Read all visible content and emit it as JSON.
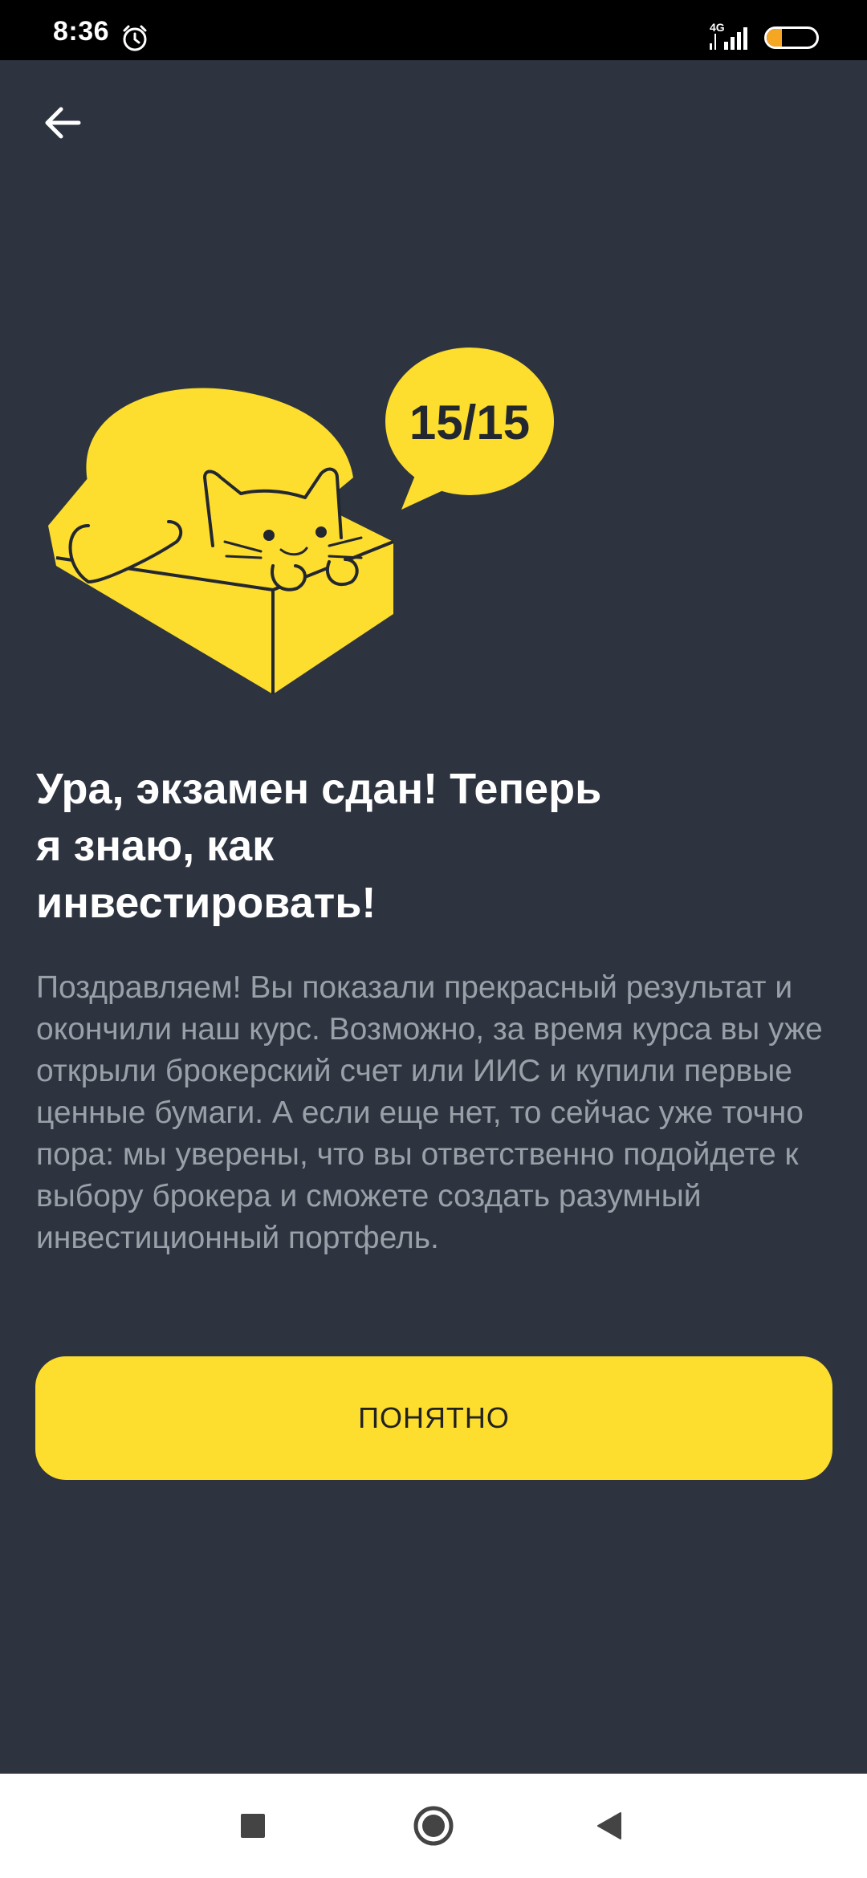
{
  "status_bar": {
    "time": "8:36",
    "network": "4G",
    "battery_level": "31",
    "battery_fraction": 0.31,
    "icons": [
      "alarm-icon",
      "signal-icon",
      "battery-icon"
    ]
  },
  "toolbar": {
    "back_icon": "arrow-left-icon"
  },
  "illustration": {
    "bubble_text": "15/15",
    "icon": "cat-in-box-illustration"
  },
  "content": {
    "title": "Ура, экзамен сдан! Теперь\nя знаю, как\nинвестировать!",
    "body": "Поздравляем! Вы показали прекрасный результат и окончили наш курс. Возможно, за время курса вы уже открыли брокерский счет или ИИС и купили первые ценные бумаги. А если еще нет, то сейчас уже точно пора: мы уверены, что вы ответственно подойдете к выбору брокера и сможете создать разумный инвестиционный портфель."
  },
  "button": {
    "label": "ПОНЯТНО"
  },
  "nav_bar": {
    "icons": [
      "recents-square-icon",
      "home-circle-icon",
      "back-triangle-icon"
    ]
  },
  "colors": {
    "background": "#2d3440",
    "accent": "#fddd2d",
    "title": "#ffffff",
    "body_text": "#9aa0a8"
  }
}
